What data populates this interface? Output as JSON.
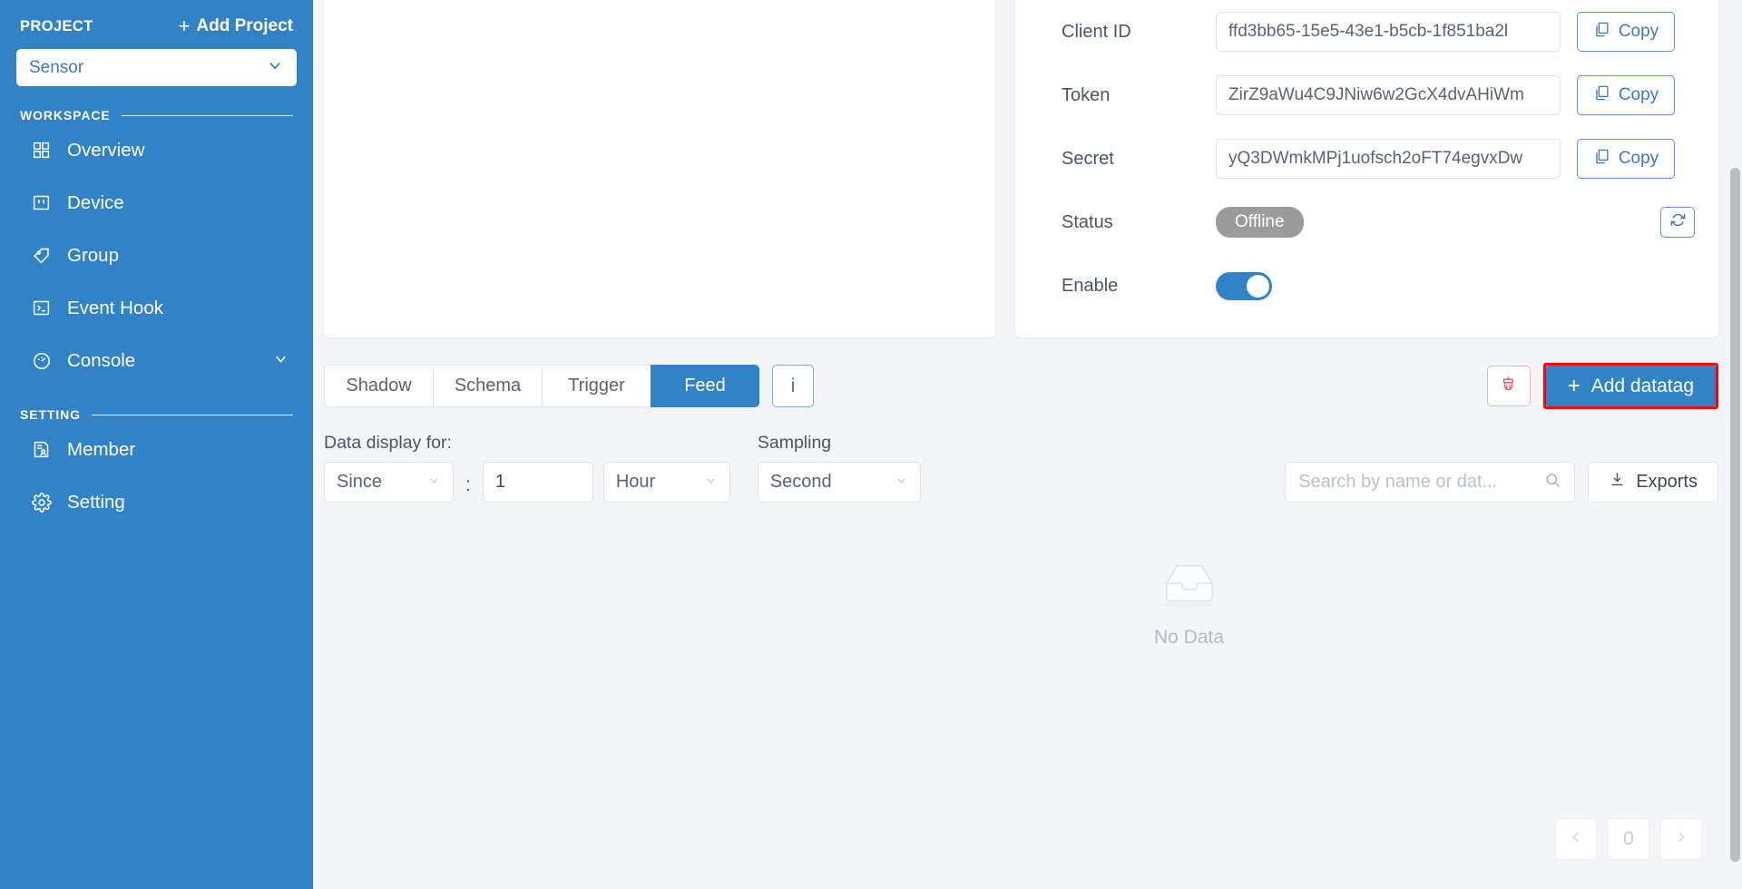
{
  "sidebar": {
    "project_label": "PROJECT",
    "add_project_label": "Add Project",
    "add_project_icon": "plus-icon",
    "project_select_value": "Sensor",
    "project_select_icon": "chevron-down-icon",
    "sections": [
      {
        "label": "WORKSPACE"
      },
      {
        "label": "SETTING"
      }
    ],
    "workspace_items": [
      {
        "label": "Overview",
        "icon": "grid-icon"
      },
      {
        "label": "Device",
        "icon": "device-icon"
      },
      {
        "label": "Group",
        "icon": "tag-icon"
      },
      {
        "label": "Event Hook",
        "icon": "terminal-icon"
      },
      {
        "label": "Console",
        "icon": "gauge-icon",
        "trailing_icon": "chevron-down-icon"
      }
    ],
    "setting_items": [
      {
        "label": "Member",
        "icon": "member-card-icon"
      },
      {
        "label": "Setting",
        "icon": "gear-icon"
      }
    ]
  },
  "details": {
    "fields": [
      {
        "label": "Client ID",
        "value": "ffd3bb65-15e5-43e1-b5cb-1f851ba2l",
        "copy_label": "Copy",
        "copy_icon": "copy-icon"
      },
      {
        "label": "Token",
        "value": "ZirZ9aWu4C9JNiw6w2GcX4dvAHiWm",
        "copy_label": "Copy",
        "copy_icon": "copy-icon"
      },
      {
        "label": "Secret",
        "value": "yQ3DWmkMPj1uofsch2oFT74egvxDw",
        "copy_label": "Copy",
        "copy_icon": "copy-icon"
      }
    ],
    "status_label": "Status",
    "status_value": "Offline",
    "status_color": "#9b9b9b",
    "refresh_icon": "refresh-icon",
    "enable_label": "Enable",
    "enable_on": true,
    "enable_color": "#3282c8"
  },
  "tabbar": {
    "tabs": [
      {
        "label": "Shadow",
        "active": false
      },
      {
        "label": "Schema",
        "active": false
      },
      {
        "label": "Trigger",
        "active": false
      },
      {
        "label": "Feed",
        "active": true
      }
    ],
    "info_label": "i",
    "clear_icon": "broom-icon",
    "add_datatag_label": "Add datatag",
    "add_datatag_icon": "plus-icon",
    "highlight_color": "#fb0007",
    "accent_color": "#3282c8"
  },
  "filters": {
    "data_display_label": "Data display for:",
    "range_mode": "Since",
    "colon": ":",
    "range_value": "1",
    "range_unit": "Hour",
    "sampling_label": "Sampling",
    "sampling_value": "Second",
    "search_placeholder": "Search by name or dat...",
    "search_icon": "search-icon",
    "exports_label": "Exports",
    "exports_icon": "download-icon"
  },
  "empty_state": {
    "text": "No Data",
    "icon": "empty-box-icon"
  },
  "pagination": {
    "prev_icon": "chevron-left-icon",
    "page": "0",
    "next_icon": "chevron-right-icon"
  }
}
